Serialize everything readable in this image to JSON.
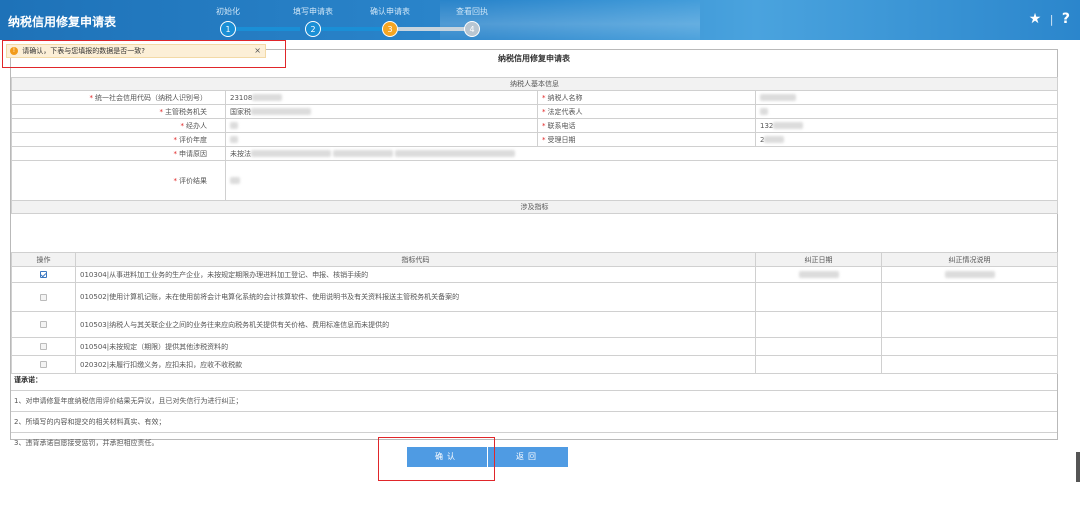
{
  "header": {
    "title": "纳税信用修复申请表",
    "steps": [
      {
        "label": "初始化",
        "number": "1",
        "state": "done"
      },
      {
        "label": "填写申请表",
        "number": "2",
        "state": "done"
      },
      {
        "label": "确认申请表",
        "number": "3",
        "state": "active"
      },
      {
        "label": "查看回执",
        "number": "4",
        "state": "pending"
      }
    ],
    "star_icon": "★",
    "separator": "|",
    "help_icon": "?",
    "colors": {
      "done": "#1a8fd6",
      "active": "#f5a623",
      "pending": "#b8c6d2"
    }
  },
  "alert": {
    "icon": "!",
    "text": "请确认，下表与您填报的数据是否一致?",
    "close": "×"
  },
  "form": {
    "title": "纳税信用修复申请表",
    "basic_section": "纳税人基本信息",
    "required_mark": "*",
    "rows": [
      {
        "label1": "统一社会信用代码（纳税人识别号）",
        "value1": "23108",
        "label2": "纳税人名称",
        "value2": ""
      },
      {
        "label1": "主管税务机关",
        "value1": "国家税",
        "label2": "法定代表人",
        "value2": ""
      },
      {
        "label1": "经办人",
        "value1": "",
        "label2": "联系电话",
        "value2": "132"
      },
      {
        "label1": "评价年度",
        "value1": "",
        "label2": "受理日期",
        "value2": "2"
      }
    ],
    "reason_label": "申请原因",
    "reason_value": "未按法",
    "result_label": "评价结果",
    "indicator_section": "涉及指标",
    "indicator_headers": {
      "op": "操作",
      "code": "指标代码",
      "date": "纠正日期",
      "desc": "纠正情况说明"
    },
    "indicators": [
      {
        "checked": true,
        "text": "010304|从事进料加工业务的生产企业，未按规定期限办理进料加工登记、申报、核销手续的"
      },
      {
        "checked": false,
        "text": "010502|使用计算机记账，未在使用前将会计电算化系统的会计核算软件、使用说明书及有关资料报送主管税务机关备案的"
      },
      {
        "checked": false,
        "text": "010503|纳税人与其关联企业之间的业务往来应向税务机关提供有关价格、费用标准信息而未提供的"
      },
      {
        "checked": false,
        "text": "010504|未按规定（期限）提供其他涉税资料的"
      },
      {
        "checked": false,
        "text": "020302|未履行扣缴义务，应扣未扣，应收不收税款"
      }
    ],
    "pledge_title": "谨承诺：",
    "pledges": [
      "1、对申请修复年度纳税信用评价结果无异议，且已对失信行为进行纠正；",
      "2、所填写的内容和提交的相关材料真实、有效；",
      "3、违背承诺自愿接受惩罚，并承担相应责任。"
    ]
  },
  "buttons": {
    "confirm": "确认",
    "back": "返回"
  }
}
